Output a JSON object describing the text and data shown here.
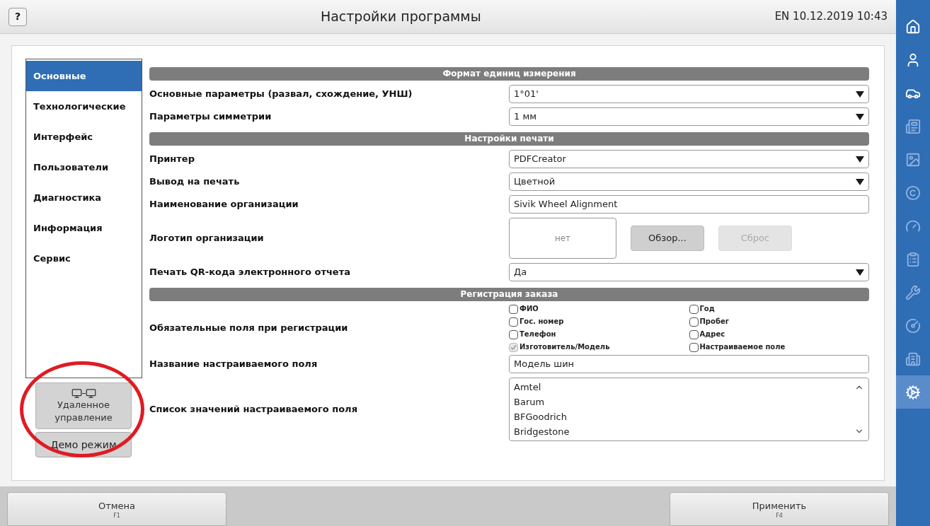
{
  "header": {
    "help": "?",
    "title": "Настройки программы",
    "status": "EN 10.12.2019 10:43"
  },
  "nav": [
    {
      "label": "Основные",
      "selected": true
    },
    {
      "label": "Технологические",
      "selected": false
    },
    {
      "label": "Интерфейс",
      "selected": false
    },
    {
      "label": "Пользователи",
      "selected": false
    },
    {
      "label": "Диагностика",
      "selected": false
    },
    {
      "label": "Информация",
      "selected": false
    },
    {
      "label": "Сервис",
      "selected": false
    }
  ],
  "remote_button": {
    "label": "Удаленное управление"
  },
  "demo_button": {
    "label": "Демо режим"
  },
  "sections": [
    {
      "title": "Формат единиц измерения",
      "rows": [
        {
          "kind": "select",
          "label": "Основные параметры (развал, схождение, УНШ)",
          "value": "1°01'"
        },
        {
          "kind": "select",
          "label": "Параметры симметрии",
          "value": "1 мм"
        }
      ]
    },
    {
      "title": "Настройки печати",
      "rows": [
        {
          "kind": "select",
          "label": "Принтер",
          "value": "PDFCreator"
        },
        {
          "kind": "select",
          "label": "Вывод на печать",
          "value": "Цветной"
        },
        {
          "kind": "input",
          "label": "Наименование организации",
          "value": "Sivik Wheel Alignment"
        },
        {
          "kind": "logo",
          "label": "Логотип организации",
          "preview": "нет",
          "buttons": [
            {
              "label": "Обзор...",
              "disabled": false
            },
            {
              "label": "Сброс",
              "disabled": true
            }
          ]
        },
        {
          "kind": "select",
          "label": "Печать QR-кода электронного отчета",
          "value": "Да"
        }
      ]
    },
    {
      "title": "Регистрация заказа",
      "rows": [
        {
          "kind": "checkboxes",
          "label": "Обязательные поля при регистрации",
          "options": [
            {
              "label": "ФИО",
              "checked": false,
              "disabled": false
            },
            {
              "label": "Год",
              "checked": false,
              "disabled": false
            },
            {
              "label": "Гос. номер",
              "checked": false,
              "disabled": false
            },
            {
              "label": "Пробег",
              "checked": false,
              "disabled": false
            },
            {
              "label": "Телефон",
              "checked": false,
              "disabled": false
            },
            {
              "label": "Адрес",
              "checked": false,
              "disabled": false
            },
            {
              "label": "Изготовитель/Модель",
              "checked": true,
              "disabled": true
            },
            {
              "label": "Настраиваемое поле",
              "checked": false,
              "disabled": false
            }
          ]
        },
        {
          "kind": "input",
          "label": "Название настраиваемого поля",
          "value": "Модель шин"
        },
        {
          "kind": "list",
          "label": "Список значений настраиваемого поля",
          "items": [
            "Amtel",
            "Barum",
            "BFGoodrich",
            "Bridgestone"
          ]
        }
      ]
    }
  ],
  "footer": [
    {
      "label": "Отмена",
      "key": "F1"
    },
    {
      "label": "Применить",
      "key": "F4"
    }
  ],
  "rail": [
    {
      "kind": "home",
      "selected": false
    },
    {
      "kind": "user",
      "selected": false
    },
    {
      "kind": "car",
      "selected": false
    },
    {
      "kind": "list",
      "selected": false
    },
    {
      "kind": "image",
      "selected": false
    },
    {
      "kind": "copyright",
      "selected": false
    },
    {
      "kind": "gauge",
      "selected": false
    },
    {
      "kind": "clipboard",
      "selected": false
    },
    {
      "kind": "wrench",
      "selected": false
    },
    {
      "kind": "gaugeplus",
      "selected": false
    },
    {
      "kind": "building",
      "selected": false
    },
    {
      "kind": "settings",
      "selected": true
    }
  ]
}
